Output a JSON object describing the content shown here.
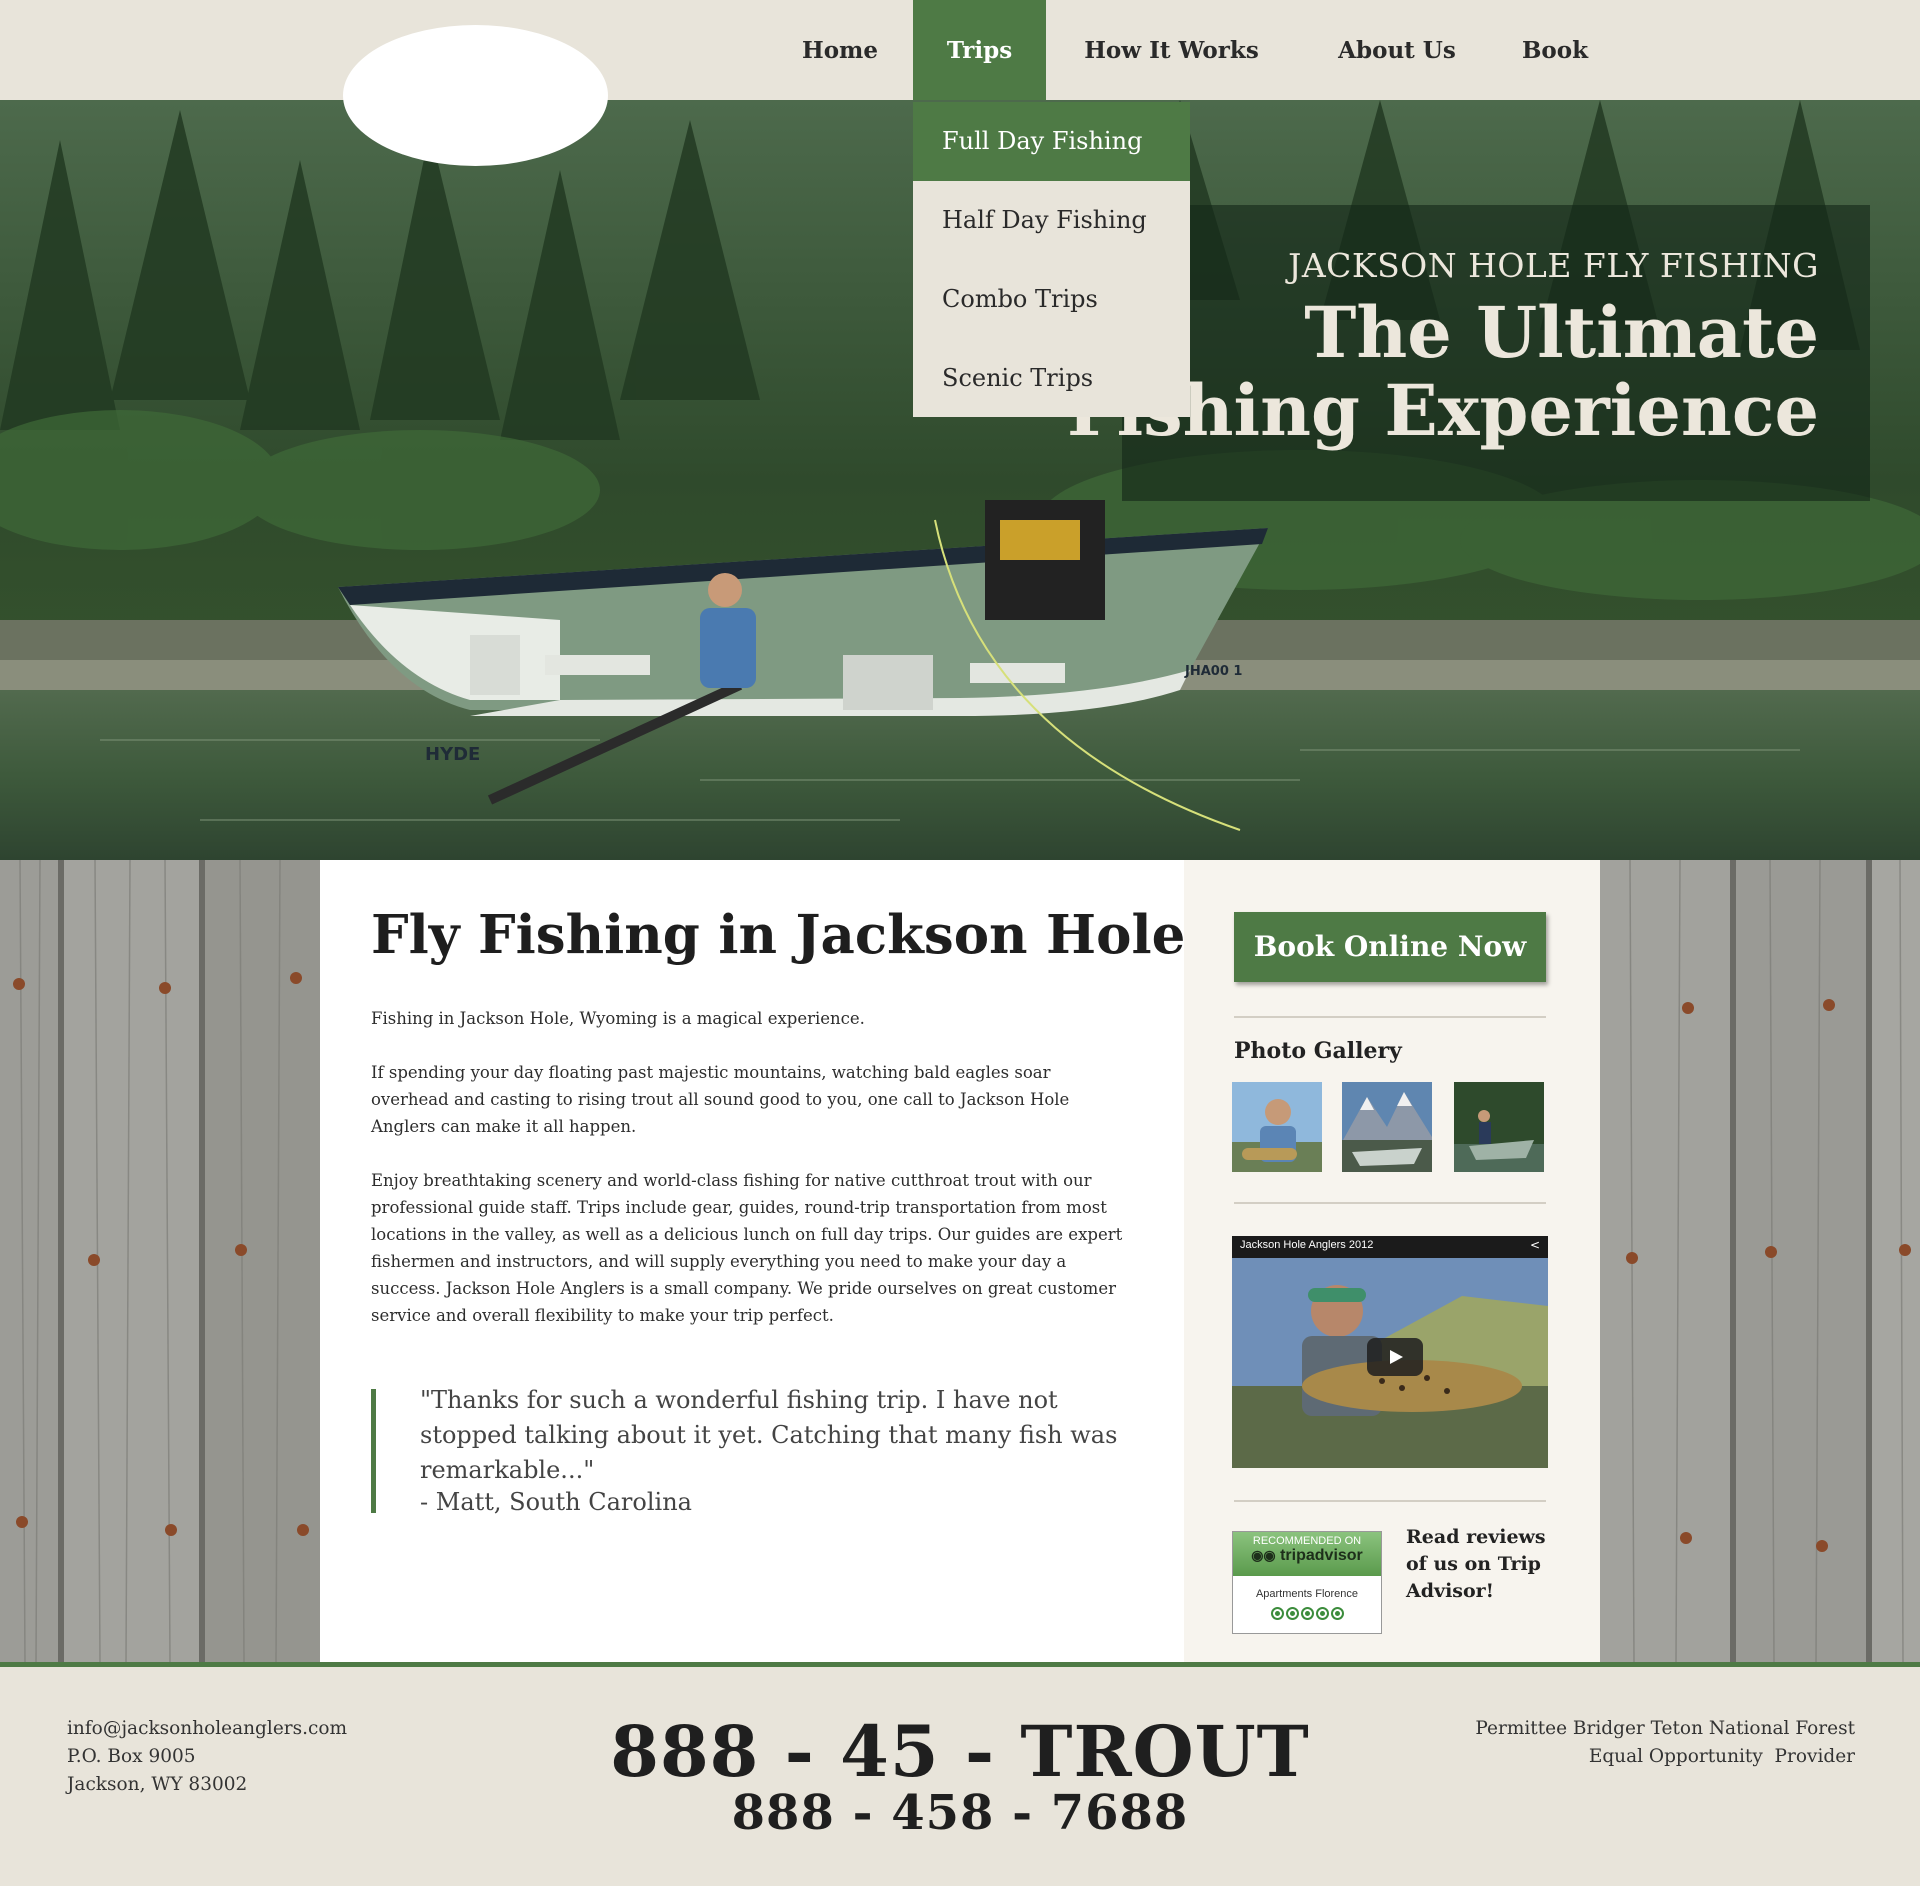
{
  "nav": {
    "items": [
      {
        "label": "Home"
      },
      {
        "label": "Trips"
      },
      {
        "label": "How It Works"
      },
      {
        "label": "About Us"
      },
      {
        "label": "Book"
      }
    ],
    "active": "Trips"
  },
  "dropdown": {
    "items": [
      {
        "label": "Full Day Fishing"
      },
      {
        "label": "Half Day Fishing"
      },
      {
        "label": "Combo Trips"
      },
      {
        "label": "Scenic Trips"
      }
    ],
    "active": "Full Day Fishing"
  },
  "hero": {
    "kicker": "JACKSON HOLE FLY FISHING",
    "title_line1": "The Ultimate",
    "title_line2": "Fishing Experience",
    "boat_text": "HYDE",
    "boat_id": "JHA00 1"
  },
  "main": {
    "title": "Fly Fishing in Jackson Hole",
    "paragraphs": [
      "Fishing in Jackson Hole, Wyoming is a magical experience.",
      "If spending your day floating past majestic mountains, watching bald eagles soar overhead and casting to rising trout all sound good to you, one call to Jackson Hole Anglers can make it all happen.",
      "Enjoy breathtaking scenery and world-class fishing for native cutthroat trout with our professional guide staff. Trips include gear, guides, round-trip transportation from most locations in the valley, as well as a delicious lunch on full day trips. Our guides are expert fishermen and instructors, and will supply everything you need to make your day a success. Jackson Hole Anglers is a small company. We pride ourselves on great customer service and overall flexibility to make your trip perfect."
    ],
    "quote": "\"Thanks for such a wonderful fishing trip. I have not stopped talking about it yet. Catching that many fish was remarkable...\"",
    "quote_author": "- Matt, South Carolina"
  },
  "sidebar": {
    "book_button": "Book Online Now",
    "gallery_title": "Photo Gallery",
    "video_title": "Jackson Hole Anglers 2012",
    "tripadvisor": {
      "recommended": "RECOMMENDED ON",
      "brand": "tripadvisor",
      "place": "Apartments Florence",
      "rating": 5
    },
    "reviews_text": "Read reviews of us on Trip Advisor!"
  },
  "footer": {
    "email": "info@jacksonholeanglers.com",
    "po_box": "P.O. Box 9005",
    "city": "Jackson, WY 83002",
    "phone_vanity": "888 - 45 - TROUT",
    "phone_number": "888 - 458 - 7688",
    "permit": "Permittee Bridger Teton National Forest",
    "equal_opportunity": "Equal Opportunity  Provider"
  },
  "colors": {
    "accent_green": "#4e7a45",
    "header_bg": "#e8e4da",
    "sidebar_bg": "#f7f4ee"
  }
}
